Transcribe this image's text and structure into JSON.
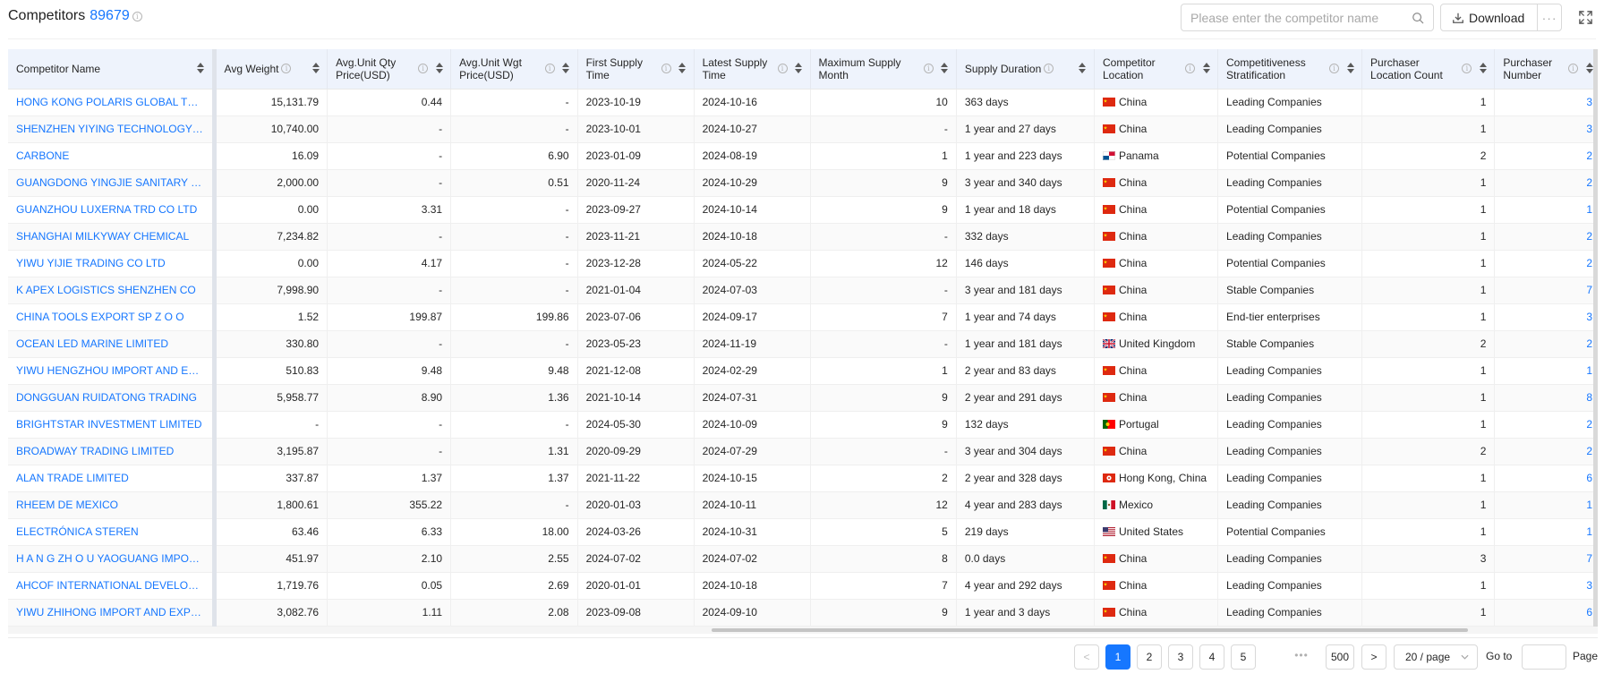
{
  "header": {
    "title": "Competitors",
    "count": "89679",
    "info_icon": "i",
    "search_placeholder": "Please enter the competitor name",
    "download_label": "Download",
    "more_label": "···"
  },
  "columns": [
    {
      "label": "Competitor Name",
      "info": false
    },
    {
      "label": "Avg Weight",
      "info": true
    },
    {
      "label": "Avg.Unit Qty Price(USD)",
      "info": true
    },
    {
      "label": "Avg.Unit Wgt Price(USD)",
      "info": true
    },
    {
      "label": "First Supply Time",
      "info": true
    },
    {
      "label": "Latest Supply Time",
      "info": true
    },
    {
      "label": "Maximum Supply Month",
      "info": true
    },
    {
      "label": "Supply Duration",
      "info": true
    },
    {
      "label": "Competitor Location",
      "info": true
    },
    {
      "label": "Competitiveness Stratification",
      "info": true
    },
    {
      "label": "Purchaser Location Count",
      "info": true
    },
    {
      "label": "Purchaser Number",
      "info": true
    }
  ],
  "rows": [
    {
      "name": "HONG KONG POLARIS GLOBAL TRADING",
      "avg_weight": "15,131.79",
      "qty_price": "0.44",
      "wgt_price": "-",
      "first": "2023-10-19",
      "latest": "2024-10-16",
      "max_month": "10",
      "duration": "363 days",
      "flag": "cn",
      "location": "China",
      "strat": "Leading Companies",
      "loc_count": "1",
      "purchasers": "3"
    },
    {
      "name": "SHENZHEN YIYING TECHNOLOGY CO",
      "avg_weight": "10,740.00",
      "qty_price": "-",
      "wgt_price": "-",
      "first": "2023-10-01",
      "latest": "2024-10-27",
      "max_month": "-",
      "duration": "1 year and 27 days",
      "flag": "cn",
      "location": "China",
      "strat": "Leading Companies",
      "loc_count": "1",
      "purchasers": "3"
    },
    {
      "name": "CARBONE",
      "avg_weight": "16.09",
      "qty_price": "-",
      "wgt_price": "6.90",
      "first": "2023-01-09",
      "latest": "2024-08-19",
      "max_month": "1",
      "duration": "1 year and 223 days",
      "flag": "pa",
      "location": "Panama",
      "strat": "Potential Companies",
      "loc_count": "2",
      "purchasers": "2"
    },
    {
      "name": "GUANGDONG YINGJIE SANITARY WARE",
      "avg_weight": "2,000.00",
      "qty_price": "-",
      "wgt_price": "0.51",
      "first": "2020-11-24",
      "latest": "2024-10-29",
      "max_month": "9",
      "duration": "3 year and 340 days",
      "flag": "cn",
      "location": "China",
      "strat": "Leading Companies",
      "loc_count": "1",
      "purchasers": "2"
    },
    {
      "name": "GUANZHOU LUXERNA TRD CO LTD",
      "avg_weight": "0.00",
      "qty_price": "3.31",
      "wgt_price": "-",
      "first": "2023-09-27",
      "latest": "2024-10-14",
      "max_month": "9",
      "duration": "1 year and 18 days",
      "flag": "cn",
      "location": "China",
      "strat": "Potential Companies",
      "loc_count": "1",
      "purchasers": "1"
    },
    {
      "name": "SHANGHAI MILKYWAY CHEMICAL",
      "avg_weight": "7,234.82",
      "qty_price": "-",
      "wgt_price": "-",
      "first": "2023-11-21",
      "latest": "2024-10-18",
      "max_month": "-",
      "duration": "332 days",
      "flag": "cn",
      "location": "China",
      "strat": "Leading Companies",
      "loc_count": "1",
      "purchasers": "2"
    },
    {
      "name": "YIWU YIJIE TRADING CO LTD",
      "avg_weight": "0.00",
      "qty_price": "4.17",
      "wgt_price": "-",
      "first": "2023-12-28",
      "latest": "2024-05-22",
      "max_month": "12",
      "duration": "146 days",
      "flag": "cn",
      "location": "China",
      "strat": "Potential Companies",
      "loc_count": "1",
      "purchasers": "2"
    },
    {
      "name": "K APEX LOGISTICS SHENZHEN CO",
      "avg_weight": "7,998.90",
      "qty_price": "-",
      "wgt_price": "-",
      "first": "2021-01-04",
      "latest": "2024-07-03",
      "max_month": "-",
      "duration": "3 year and 181 days",
      "flag": "cn",
      "location": "China",
      "strat": "Stable Companies",
      "loc_count": "1",
      "purchasers": "7"
    },
    {
      "name": "CHINA TOOLS EXPORT SP Z O O",
      "avg_weight": "1.52",
      "qty_price": "199.87",
      "wgt_price": "199.86",
      "first": "2023-07-06",
      "latest": "2024-09-17",
      "max_month": "7",
      "duration": "1 year and 74 days",
      "flag": "cn",
      "location": "China",
      "strat": "End-tier enterprises",
      "loc_count": "1",
      "purchasers": "3"
    },
    {
      "name": "OCEAN LED MARINE LIMITED",
      "avg_weight": "330.80",
      "qty_price": "-",
      "wgt_price": "-",
      "first": "2023-05-23",
      "latest": "2024-11-19",
      "max_month": "-",
      "duration": "1 year and 181 days",
      "flag": "gb",
      "location": "United Kingdom",
      "strat": "Stable Companies",
      "loc_count": "2",
      "purchasers": "2"
    },
    {
      "name": "YIWU HENGZHOU IMPORT AND EXPORT",
      "avg_weight": "510.83",
      "qty_price": "9.48",
      "wgt_price": "9.48",
      "first": "2021-12-08",
      "latest": "2024-02-29",
      "max_month": "1",
      "duration": "2 year and 83 days",
      "flag": "cn",
      "location": "China",
      "strat": "Leading Companies",
      "loc_count": "1",
      "purchasers": "1"
    },
    {
      "name": "DONGGUAN RUIDATONG TRADING",
      "avg_weight": "5,958.77",
      "qty_price": "8.90",
      "wgt_price": "1.36",
      "first": "2021-10-14",
      "latest": "2024-07-31",
      "max_month": "9",
      "duration": "2 year and 291 days",
      "flag": "cn",
      "location": "China",
      "strat": "Leading Companies",
      "loc_count": "1",
      "purchasers": "8"
    },
    {
      "name": "BRIGHTSTAR INVESTMENT LIMITED",
      "avg_weight": "-",
      "qty_price": "-",
      "wgt_price": "-",
      "first": "2024-05-30",
      "latest": "2024-10-09",
      "max_month": "9",
      "duration": "132 days",
      "flag": "pt",
      "location": "Portugal",
      "strat": "Leading Companies",
      "loc_count": "1",
      "purchasers": "2"
    },
    {
      "name": "BROADWAY TRADING LIMITED",
      "avg_weight": "3,195.87",
      "qty_price": "-",
      "wgt_price": "1.31",
      "first": "2020-09-29",
      "latest": "2024-07-29",
      "max_month": "-",
      "duration": "3 year and 304 days",
      "flag": "cn",
      "location": "China",
      "strat": "Leading Companies",
      "loc_count": "2",
      "purchasers": "2"
    },
    {
      "name": "ALAN TRADE LIMITED",
      "avg_weight": "337.87",
      "qty_price": "1.37",
      "wgt_price": "1.37",
      "first": "2021-11-22",
      "latest": "2024-10-15",
      "max_month": "2",
      "duration": "2 year and 328 days",
      "flag": "hk",
      "location": "Hong Kong, China",
      "strat": "Leading Companies",
      "loc_count": "1",
      "purchasers": "6"
    },
    {
      "name": "RHEEM DE MEXICO",
      "avg_weight": "1,800.61",
      "qty_price": "355.22",
      "wgt_price": "-",
      "first": "2020-01-03",
      "latest": "2024-10-11",
      "max_month": "12",
      "duration": "4 year and 283 days",
      "flag": "mx",
      "location": "Mexico",
      "strat": "Leading Companies",
      "loc_count": "1",
      "purchasers": "1"
    },
    {
      "name": "ELECTRÓNICA STEREN",
      "avg_weight": "63.46",
      "qty_price": "6.33",
      "wgt_price": "18.00",
      "first": "2024-03-26",
      "latest": "2024-10-31",
      "max_month": "5",
      "duration": "219 days",
      "flag": "us",
      "location": "United States",
      "strat": "Potential Companies",
      "loc_count": "1",
      "purchasers": "1"
    },
    {
      "name": "H A N G ZH O U YAOGUANG IMPORT AND EXPORT",
      "avg_weight": "451.97",
      "qty_price": "2.10",
      "wgt_price": "2.55",
      "first": "2024-07-02",
      "latest": "2024-07-02",
      "max_month": "8",
      "duration": "0.0 days",
      "flag": "cn",
      "location": "China",
      "strat": "Leading Companies",
      "loc_count": "3",
      "purchasers": "7"
    },
    {
      "name": "AHCOF INTERNATIONAL DEVELOPMENT",
      "avg_weight": "1,719.76",
      "qty_price": "0.05",
      "wgt_price": "2.69",
      "first": "2020-01-01",
      "latest": "2024-10-18",
      "max_month": "7",
      "duration": "4 year and 292 days",
      "flag": "cn",
      "location": "China",
      "strat": "Leading Companies",
      "loc_count": "1",
      "purchasers": "3"
    },
    {
      "name": "YIWU ZHIHONG IMPORT AND EXPORT",
      "avg_weight": "3,082.76",
      "qty_price": "1.11",
      "wgt_price": "2.08",
      "first": "2023-09-08",
      "latest": "2024-09-10",
      "max_month": "9",
      "duration": "1 year and 3 days",
      "flag": "cn",
      "location": "China",
      "strat": "Leading Companies",
      "loc_count": "1",
      "purchasers": "6"
    }
  ],
  "pagination": {
    "prev": "<",
    "pages": [
      "1",
      "2",
      "3",
      "4",
      "5"
    ],
    "current": "1",
    "ellipsis": "•••",
    "last": "500",
    "next": ">",
    "page_size": "20 / page",
    "goto_label": "Go to",
    "page_label": "Page"
  },
  "colors": {
    "accent": "#1677ff",
    "header_bg": "#eef3fc"
  }
}
